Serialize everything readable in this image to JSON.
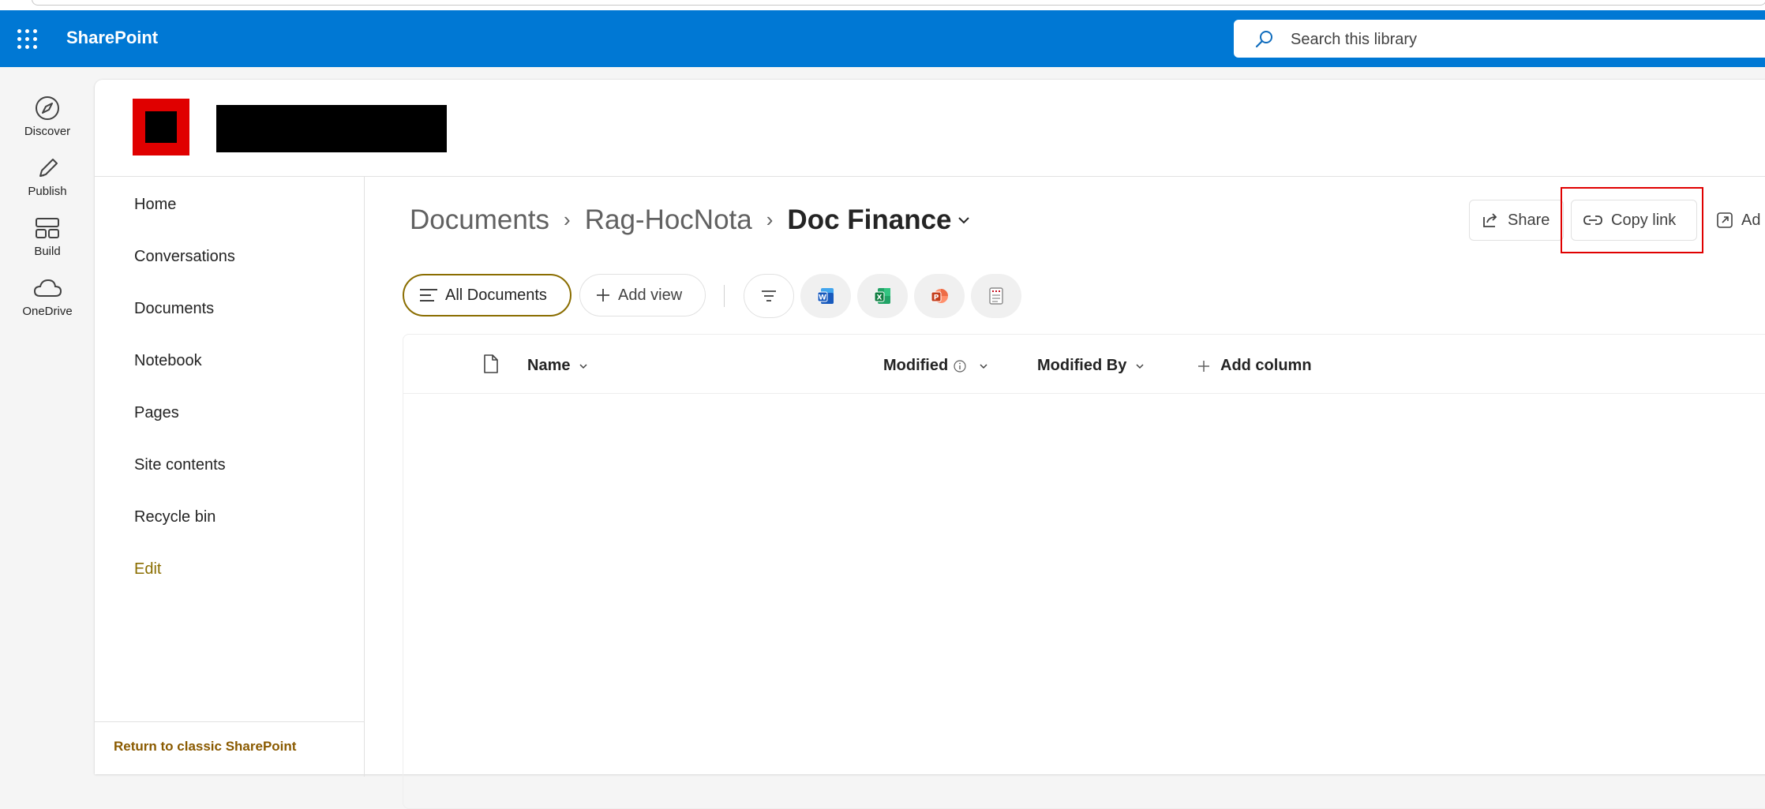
{
  "suite": {
    "brand": "SharePoint",
    "search_placeholder": "Search this library"
  },
  "app_rail": [
    {
      "label": "Discover",
      "icon": "compass-icon"
    },
    {
      "label": "Publish",
      "icon": "pen-icon"
    },
    {
      "label": "Build",
      "icon": "layout-icon"
    },
    {
      "label": "OneDrive",
      "icon": "cloud-icon"
    }
  ],
  "left_nav": {
    "items": [
      "Home",
      "Conversations",
      "Documents",
      "Notebook",
      "Pages",
      "Site contents",
      "Recycle bin"
    ],
    "edit_label": "Edit",
    "classic_link": "Return to classic SharePoint"
  },
  "breadcrumb": {
    "items": [
      "Documents",
      "Rag-HocNota"
    ],
    "current": "Doc Finance",
    "separator": "›"
  },
  "commands": {
    "share_label": "Share",
    "copy_link_label": "Copy link",
    "add_label": "Ad"
  },
  "views": {
    "active_view": "All Documents",
    "add_view_label": "Add view"
  },
  "new_doc_icons": [
    "word-icon",
    "excel-icon",
    "powerpoint-icon",
    "forms-icon"
  ],
  "list": {
    "columns": {
      "name": "Name",
      "modified": "Modified",
      "modified_by": "Modified By",
      "add_column": "Add column"
    }
  },
  "colors": {
    "suite_blue": "#0078d4",
    "accent_gold": "#8a6d00",
    "highlight_red": "#e00000"
  }
}
